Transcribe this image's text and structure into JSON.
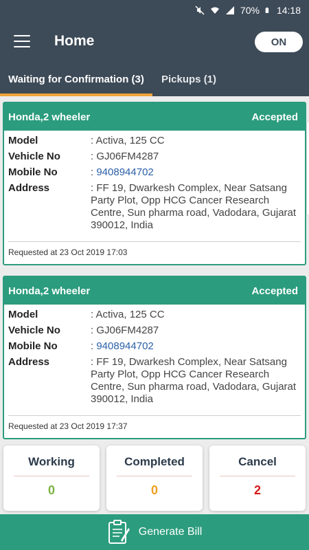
{
  "status_bar": {
    "battery": "70%",
    "time": "14:18",
    "icons": [
      "mute-icon",
      "wifi-icon",
      "signal-icon",
      "battery-icon"
    ]
  },
  "app_bar": {
    "title": "Home",
    "menu_icon": "menu-icon",
    "toggle_label": "ON"
  },
  "tabs": [
    {
      "label": "Waiting for Confirmation (3)",
      "active": true
    },
    {
      "label": "Pickups (1)",
      "active": false
    }
  ],
  "field_labels": {
    "model": "Model",
    "vehicle_no": "Vehicle No",
    "mobile_no": "Mobile No",
    "address": "Address"
  },
  "requests": [
    {
      "title": "Honda,2 wheeler",
      "status": "Accepted",
      "model": ": Activa, 125 CC",
      "vehicle_no": ": GJ06FM4287",
      "mobile_prefix": ": ",
      "mobile_no": "9408944702",
      "address": ": FF 19, Dwarkesh Complex, Near Satsang Party Plot, Opp HCG Cancer Research Centre, Sun pharma road, Vadodara, Gujarat 390012, India",
      "requested": "Requested at 23 Oct 2019 17:03"
    },
    {
      "title": "Honda,2 wheeler",
      "status": "Accepted",
      "model": ": Activa, 125 CC",
      "vehicle_no": ": GJ06FM4287",
      "mobile_prefix": ": ",
      "mobile_no": "9408944702",
      "address": ": FF 19, Dwarkesh Complex, Near Satsang Party Plot, Opp HCG Cancer Research Centre, Sun pharma road, Vadodara, Gujarat 390012, India",
      "requested": "Requested at 23 Oct 2019 17:37"
    }
  ],
  "stats": [
    {
      "label": "Working",
      "count": "0",
      "color": "#7cb342"
    },
    {
      "label": "Completed",
      "count": "0",
      "color": "#f0a020"
    },
    {
      "label": "Cancel",
      "count": "2",
      "color": "#d81b1b"
    }
  ],
  "bottom_button": {
    "label": "Generate Bill",
    "icon": "bill-icon"
  },
  "colors": {
    "primary_dark": "#3d4a57",
    "accent_green": "#2b9c7d",
    "tab_indicator": "#f0a33a"
  }
}
